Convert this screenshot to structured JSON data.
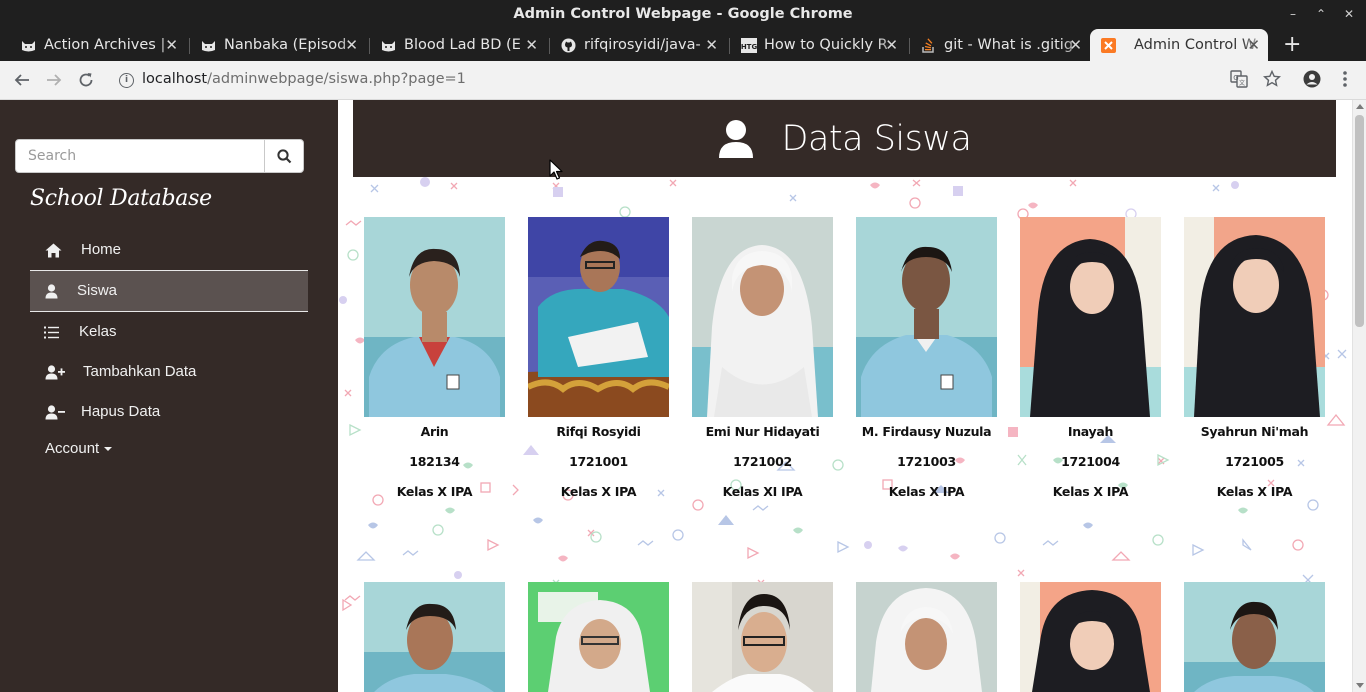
{
  "window": {
    "title": "Admin Control Webpage - Google Chrome",
    "controls": [
      "–",
      "⌃",
      "✕"
    ]
  },
  "tabs": [
    {
      "title": "Action Archives | ",
      "favicon": "cat-icon",
      "active": false
    },
    {
      "title": "Nanbaka (Episod",
      "favicon": "cat-icon",
      "active": false
    },
    {
      "title": "Blood Lad BD (E",
      "favicon": "cat-icon",
      "active": false
    },
    {
      "title": "rifqirosyidi/java-",
      "favicon": "github-icon",
      "active": false
    },
    {
      "title": "How to Quickly R",
      "favicon": "htg-icon",
      "active": false
    },
    {
      "title": "git - What is .gitig",
      "favicon": "stackoverflow-icon",
      "active": false
    },
    {
      "title": "Admin Control W",
      "favicon": "xampp-icon",
      "active": true
    }
  ],
  "toolbar": {
    "url_host": "localhost",
    "url_path": "/adminwebpage/siswa.php?page=1"
  },
  "sidebar": {
    "search_placeholder": "Search",
    "brand": "School Database",
    "items": [
      {
        "label": "Home",
        "icon": "home-icon",
        "active": false
      },
      {
        "label": "Siswa",
        "icon": "user-icon",
        "active": true
      },
      {
        "label": "Kelas",
        "icon": "list-icon",
        "active": false
      },
      {
        "label": "Tambahkan Data",
        "icon": "user-plus-icon",
        "active": false
      },
      {
        "label": "Hapus Data",
        "icon": "user-minus-icon",
        "active": false
      }
    ],
    "account_label": "Account"
  },
  "main": {
    "title": "Data Siswa",
    "students": [
      {
        "name": "Arin",
        "nis": "182134",
        "kelas": "Kelas X IPA"
      },
      {
        "name": "Rifqi Rosyidi",
        "nis": "1721001",
        "kelas": "Kelas X IPA"
      },
      {
        "name": "Emi Nur Hidayati",
        "nis": "1721002",
        "kelas": "Kelas XI IPA"
      },
      {
        "name": "M. Firdausy Nuzula",
        "nis": "1721003",
        "kelas": "Kelas X IPA"
      },
      {
        "name": "Inayah",
        "nis": "1721004",
        "kelas": "Kelas X IPA"
      },
      {
        "name": "Syahrun Ni'mah",
        "nis": "1721005",
        "kelas": "Kelas X IPA"
      }
    ]
  },
  "colors": {
    "sidebar_bg": "#342a27",
    "header_bg": "#342a27",
    "active_item": "#5b5250"
  }
}
